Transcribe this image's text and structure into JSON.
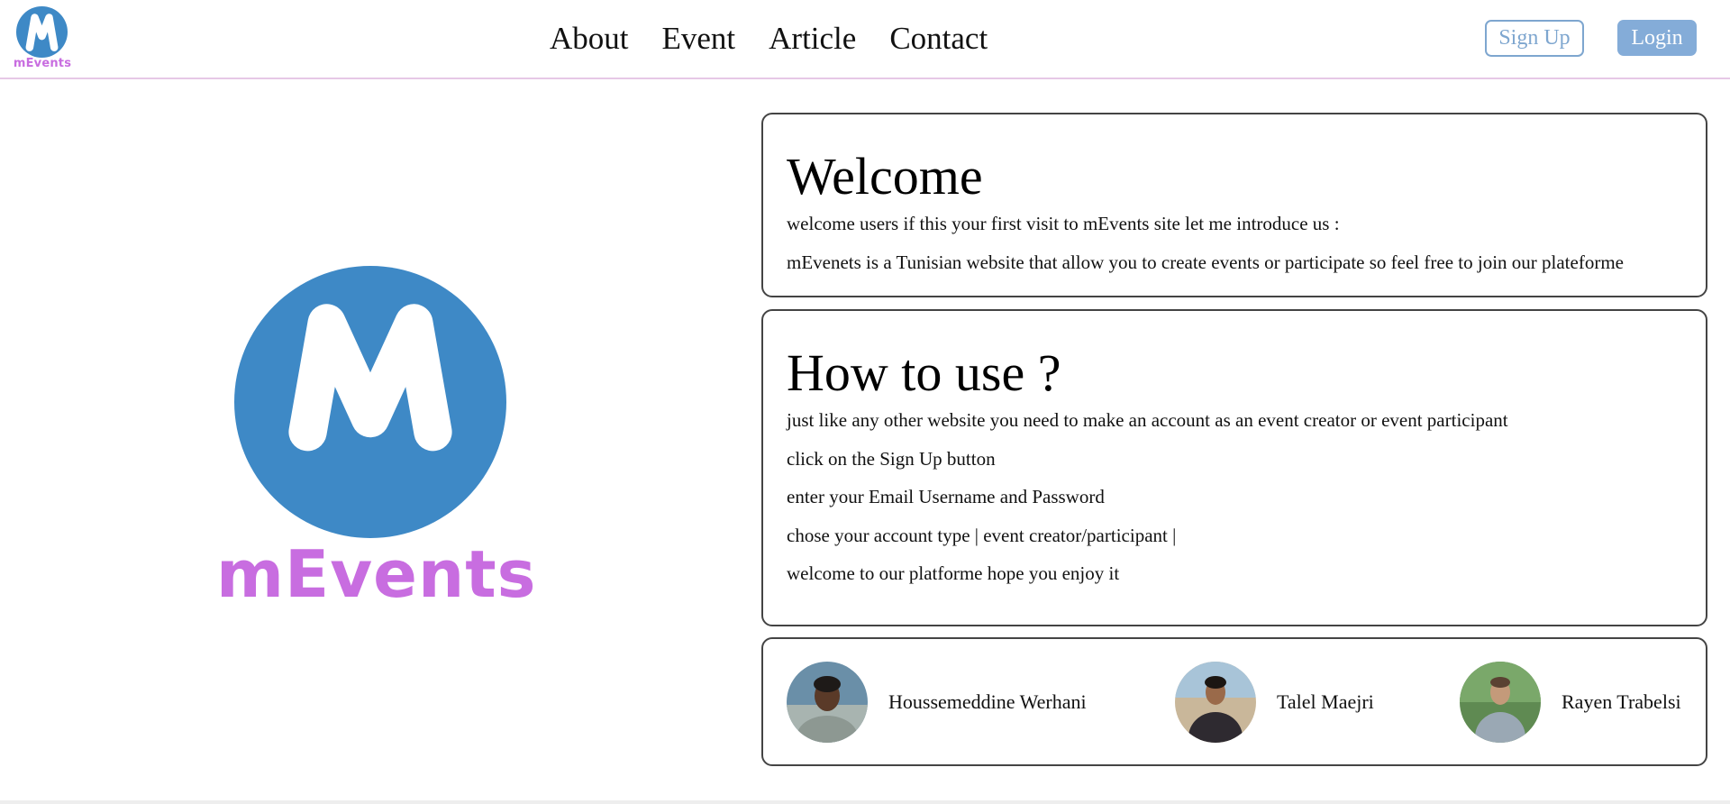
{
  "brand": {
    "name": "mEvents",
    "logo_letter": "M",
    "logo_circle_color": "#3e89c6",
    "wordmark_color": "#c86de0",
    "logo_icon": "m-logo-icon"
  },
  "nav": {
    "items": [
      {
        "label": "About"
      },
      {
        "label": "Event"
      },
      {
        "label": "Article"
      },
      {
        "label": "Contact"
      }
    ]
  },
  "auth": {
    "signup_label": "Sign Up",
    "login_label": "Login",
    "accent_color": "#7ea6cf"
  },
  "welcome": {
    "title": "Welcome",
    "lines": [
      "welcome users if this your first visit to mEvents site let me introduce us :",
      "mEvenets is a Tunisian website that allow you to create events or participate so feel free to join our plateforme"
    ]
  },
  "howto": {
    "title": "How to use ?",
    "lines": [
      "just like any other website you need to make an account as an event creator or event participant",
      "click on the Sign Up button",
      "enter your Email Username and Password",
      "chose your account type | event creator/participant |",
      "welcome to our platforme hope you enjoy it"
    ]
  },
  "team": {
    "members": [
      {
        "name": "Houssemeddine Werhani"
      },
      {
        "name": "Talel Maejri"
      },
      {
        "name": "Rayen Trabelsi"
      }
    ]
  }
}
